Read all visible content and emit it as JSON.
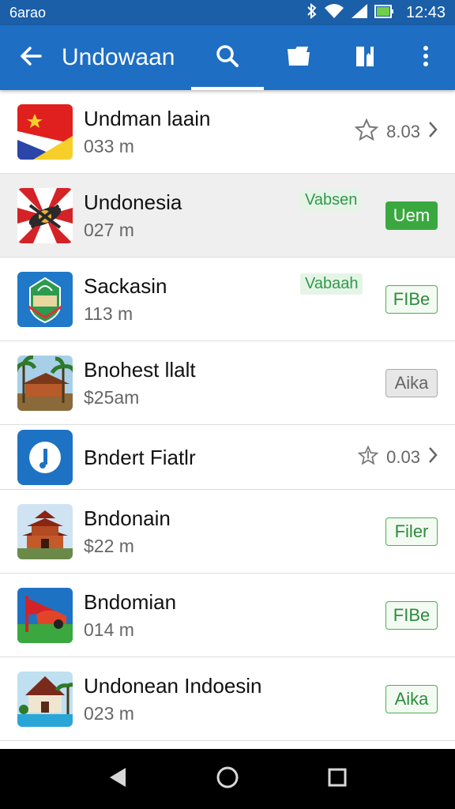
{
  "status_bar": {
    "carrier": "6arao",
    "time": "12:43"
  },
  "app_bar": {
    "title": "Undowaan",
    "icons": [
      "back-arrow-icon",
      "search-icon",
      "folder-icon",
      "book-icon",
      "more-vert-icon"
    ]
  },
  "colors": {
    "primary": "#1e6ec4",
    "status_bar": "#1a5fa8",
    "accent_green": "#3aa83f"
  },
  "items": [
    {
      "name": "Undman laain",
      "sub": "033 m",
      "rating": "8.03",
      "icon": "flag-icon"
    },
    {
      "name": "Undonesia",
      "sub": "027 m",
      "tag": "Vabsen",
      "button": "Uem",
      "icon": "emblem-icon"
    },
    {
      "name": "Sackasin",
      "sub": "113 m",
      "tag": "Vabaah",
      "button": "FIBe",
      "icon": "shield-icon"
    },
    {
      "name": "Bnohest llalt",
      "sub": "$25am",
      "button": "Aika",
      "icon": "resort-icon"
    },
    {
      "name": "Bndert Fiatlr",
      "rating": "0.03",
      "icon": "info-icon"
    },
    {
      "name": "Bndonain",
      "sub": "$22 m",
      "button": "Filer",
      "icon": "pagoda-icon"
    },
    {
      "name": "Bndomian",
      "sub": "014 m",
      "button": "FIBe",
      "icon": "tool-icon"
    },
    {
      "name": "Undonean Indoesin",
      "sub": "023 m",
      "button": "Aika",
      "icon": "house-icon"
    }
  ]
}
